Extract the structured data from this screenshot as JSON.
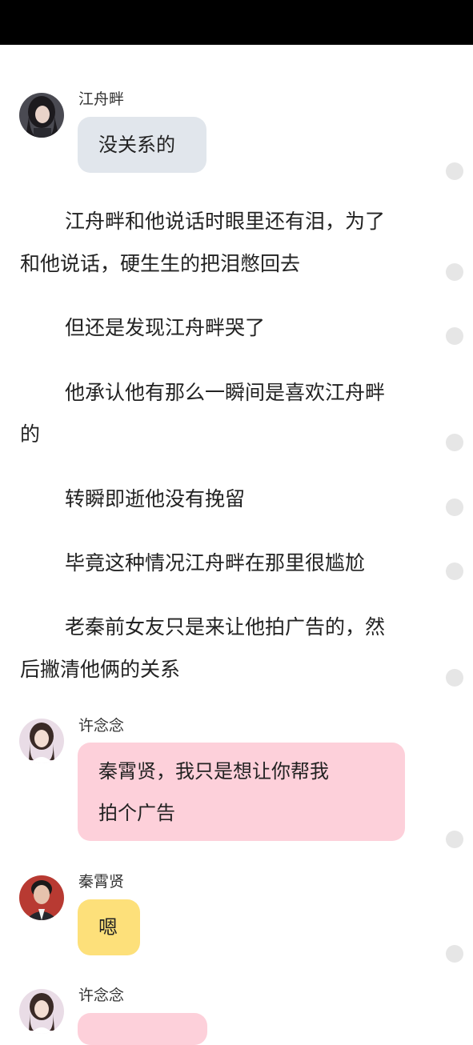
{
  "messages": [
    {
      "speaker": "江舟畔",
      "text": "没关系的"
    },
    {
      "speaker": "许念念",
      "lines": [
        "秦霄贤，我只是想让你帮我",
        "拍个广告"
      ]
    },
    {
      "speaker": "秦霄贤",
      "text": "嗯"
    },
    {
      "speaker": "许念念"
    }
  ],
  "paragraphs": [
    [
      "江舟畔和他说话时眼里还有泪，为了",
      "和他说话，硬生生的把泪憋回去"
    ],
    [
      "但还是发现江舟畔哭了"
    ],
    [
      "他承认他有那么一瞬间是喜欢江舟畔",
      "的"
    ],
    [
      "转瞬即逝他没有挽留"
    ],
    [
      "毕竟这种情况江舟畔在那里很尴尬"
    ],
    [
      "老秦前女友只是来让他拍广告的，然",
      "后撇清他俩的关系"
    ]
  ],
  "icons": {
    "avatar_1": "avatar-dark-hair-girl",
    "avatar_2": "avatar-girl-white-top",
    "avatar_3": "avatar-man-dark-suit",
    "comment_dot": "paragraph-comment-dot"
  },
  "colors": {
    "bubble_gray": "#e1e6ec",
    "bubble_pink": "#fdd0da",
    "bubble_yellow": "#fde07a",
    "status_bar": "#000000"
  }
}
